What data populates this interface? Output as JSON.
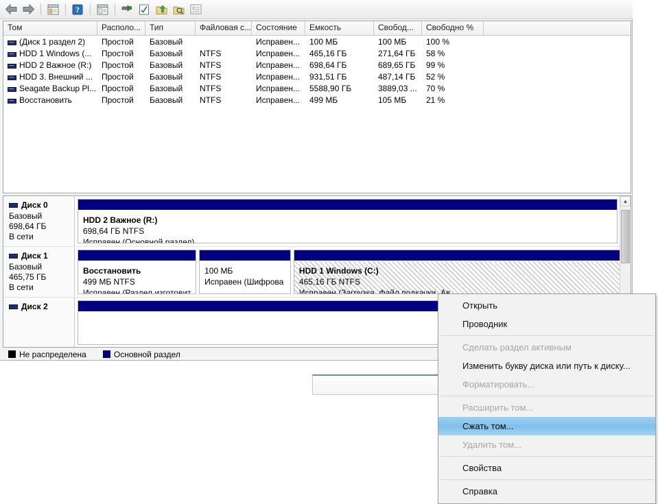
{
  "toolbar": {
    "buttons": [
      {
        "name": "back-arrow-icon",
        "label": "Назад"
      },
      {
        "name": "forward-arrow-icon",
        "label": "Вперед"
      },
      {
        "name": "show-hide-tree-icon",
        "label": "Показать/скрыть дерево"
      },
      {
        "name": "help-icon",
        "label": "Справка"
      },
      {
        "name": "properties-icon",
        "label": "Свойства"
      },
      {
        "name": "rescan-disks-icon",
        "label": "Повторить проверку дисков"
      },
      {
        "name": "task-icon",
        "label": "Задача"
      },
      {
        "name": "export-icon",
        "label": "Экспорт"
      },
      {
        "name": "search-icon",
        "label": "Поиск"
      },
      {
        "name": "list-view-icon",
        "label": "Вид списка"
      }
    ]
  },
  "volume_list": {
    "columns": [
      {
        "key": "volume",
        "label": "Том"
      },
      {
        "key": "layout",
        "label": "Располо..."
      },
      {
        "key": "type",
        "label": "Тип"
      },
      {
        "key": "fs",
        "label": "Файловая с..."
      },
      {
        "key": "status",
        "label": "Состояние"
      },
      {
        "key": "capacity",
        "label": "Емкость"
      },
      {
        "key": "free",
        "label": "Свобод..."
      },
      {
        "key": "free_pct",
        "label": "Свободно %"
      },
      {
        "key": "spare",
        "label": ""
      }
    ],
    "rows": [
      {
        "volume": "(Диск 1 раздел 2)",
        "layout": "Простой",
        "type": "Базовый",
        "fs": "",
        "status": "Исправен...",
        "capacity": "100 МБ",
        "free": "100 МБ",
        "free_pct": "100 %"
      },
      {
        "volume": "HDD 1 Windows (...",
        "layout": "Простой",
        "type": "Базовый",
        "fs": "NTFS",
        "status": "Исправен...",
        "capacity": "465,16 ГБ",
        "free": "271,64 ГБ",
        "free_pct": "58 %"
      },
      {
        "volume": "HDD 2 Важное (R:)",
        "layout": "Простой",
        "type": "Базовый",
        "fs": "NTFS",
        "status": "Исправен...",
        "capacity": "698,64 ГБ",
        "free": "689,65 ГБ",
        "free_pct": "99 %"
      },
      {
        "volume": "HDD 3. Внешний ...",
        "layout": "Простой",
        "type": "Базовый",
        "fs": "NTFS",
        "status": "Исправен...",
        "capacity": "931,51 ГБ",
        "free": "487,14 ГБ",
        "free_pct": "52 %"
      },
      {
        "volume": "Seagate Backup Pl...",
        "layout": "Простой",
        "type": "Базовый",
        "fs": "NTFS",
        "status": "Исправен...",
        "capacity": "5588,90 ГБ",
        "free": "3889,03 ...",
        "free_pct": "70 %"
      },
      {
        "volume": "Восстановить",
        "layout": "Простой",
        "type": "Базовый",
        "fs": "NTFS",
        "status": "Исправен...",
        "capacity": "499 МБ",
        "free": "105 МБ",
        "free_pct": "21 %"
      }
    ]
  },
  "graphical_view": {
    "disks": [
      {
        "name": "Диск 0",
        "type": "Базовый",
        "size": "698,64 ГБ",
        "state": "В сети",
        "partitions": [
          {
            "title": "HDD 2 Важное  (R:)",
            "size_fs": "698,64 ГБ NTFS",
            "status": "Исправен (Основной раздел)",
            "width_pct": 100,
            "hatched": false,
            "bar_color": "#000080"
          }
        ]
      },
      {
        "name": "Диск 1",
        "type": "Базовый",
        "size": "465,75 ГБ",
        "state": "В сети",
        "partitions": [
          {
            "title": "Восстановить",
            "size_fs": "499 МБ NTFS",
            "status": "Исправен (Раздел изготовит",
            "width_pct": 22,
            "hatched": false,
            "bar_color": "#000080"
          },
          {
            "title": "",
            "size_fs": "100 МБ",
            "status": "Исправен (Шифрова",
            "width_pct": 17,
            "hatched": false,
            "bar_color": "#000080"
          },
          {
            "title": "HDD 1 Windows  (C:)",
            "size_fs": "465,16 ГБ NTFS",
            "status": "Исправен (Загрузка, Файл подкачки, Ав",
            "width_pct": 61,
            "hatched": true,
            "bar_color": "#000080"
          }
        ]
      },
      {
        "name": "Диск 2",
        "type": "",
        "size": "",
        "state": "",
        "partitions": [
          {
            "title": "",
            "size_fs": "",
            "status": "",
            "width_pct": 100,
            "hatched": false,
            "bar_color": "#000080"
          }
        ]
      }
    ]
  },
  "legend": {
    "entries": [
      {
        "label": "Не распределена",
        "color": "#000000"
      },
      {
        "label": "Основной раздел",
        "color": "#000080"
      }
    ]
  },
  "context_menu": {
    "items": [
      {
        "label": "Открыть",
        "disabled": false,
        "selected": false,
        "separator_after": false
      },
      {
        "label": "Проводник",
        "disabled": false,
        "selected": false,
        "separator_after": true
      },
      {
        "label": "Сделать раздел активным",
        "disabled": true,
        "selected": false,
        "separator_after": false
      },
      {
        "label": "Изменить букву диска или путь к диску...",
        "disabled": false,
        "selected": false,
        "separator_after": false
      },
      {
        "label": "Форматировать...",
        "disabled": true,
        "selected": false,
        "separator_after": true
      },
      {
        "label": "Расширить том...",
        "disabled": true,
        "selected": false,
        "separator_after": false
      },
      {
        "label": "Сжать том...",
        "disabled": false,
        "selected": true,
        "separator_after": false
      },
      {
        "label": "Удалить том...",
        "disabled": true,
        "selected": false,
        "separator_after": true
      },
      {
        "label": "Свойства",
        "disabled": false,
        "selected": false,
        "separator_after": true
      },
      {
        "label": "Справка",
        "disabled": false,
        "selected": false,
        "separator_after": false
      }
    ],
    "highlight_color": "#7ec0ec"
  }
}
